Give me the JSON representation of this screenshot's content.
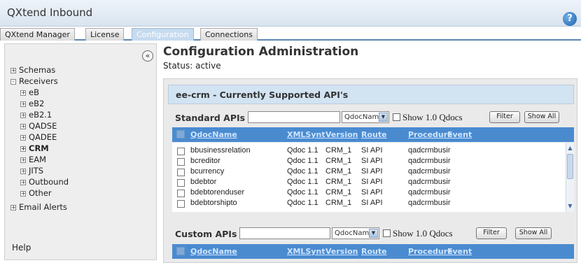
{
  "app": {
    "title": "QXtend Inbound",
    "help_glyph": "?"
  },
  "tabs": [
    {
      "label": "QXtend Manager",
      "active": false
    },
    {
      "label": "License",
      "active": false
    },
    {
      "label": "Configuration",
      "active": true
    },
    {
      "label": "Connections",
      "active": false
    }
  ],
  "sidebar": {
    "collapse_glyph": "«",
    "items": [
      {
        "label": "Schemas",
        "expander": "+"
      },
      {
        "label": "Receivers",
        "expander": "-"
      },
      {
        "label": "eB",
        "expander": "+"
      },
      {
        "label": "eB2",
        "expander": "+"
      },
      {
        "label": "eB2.1",
        "expander": "+"
      },
      {
        "label": "QADSE",
        "expander": "+"
      },
      {
        "label": "QADEE",
        "expander": "+"
      },
      {
        "label": "CRM",
        "expander": "+"
      },
      {
        "label": "EAM",
        "expander": "+"
      },
      {
        "label": "JITS",
        "expander": "+"
      },
      {
        "label": "Outbound",
        "expander": "+"
      },
      {
        "label": "Other",
        "expander": "+"
      },
      {
        "label": "Email Alerts",
        "expander": "+"
      }
    ],
    "help_label": "Help"
  },
  "main": {
    "title": "Configuration Administration",
    "status": "Status: active",
    "panel_title": "ee-crm - Currently Supported API's"
  },
  "standard": {
    "label": "Standard APIs",
    "select_value": "QdocName",
    "show_label": "Show 1.0 Qdocs",
    "filter_label": "Filter",
    "show_all_label": "Show All",
    "columns": [
      "QdocName",
      "XMLSynt",
      "Version",
      "Route",
      "Procedure",
      "Event"
    ],
    "rows": [
      [
        "bbusinessrelation",
        "Qdoc 1.1",
        "CRM_1",
        "SI API",
        "qadcrmbusir",
        ""
      ],
      [
        "bcreditor",
        "Qdoc 1.1",
        "CRM_1",
        "SI API",
        "qadcrmbusir",
        ""
      ],
      [
        "bcurrency",
        "Qdoc 1.1",
        "CRM_1",
        "SI API",
        "qadcrmbusir",
        ""
      ],
      [
        "bdebtor",
        "Qdoc 1.1",
        "CRM_1",
        "SI API",
        "qadcrmbusir",
        ""
      ],
      [
        "bdebtorenduser",
        "Qdoc 1.1",
        "CRM_1",
        "SI API",
        "qadcrmbusir",
        ""
      ],
      [
        "bdebtorshipto",
        "Qdoc 1.1",
        "CRM_1",
        "SI API",
        "qadcrmbusir",
        ""
      ]
    ]
  },
  "custom": {
    "label": "Custom APIs",
    "select_value": "QdocName",
    "show_label": "Show 1.0 Qdocs",
    "filter_label": "Filter",
    "show_all_label": "Show All",
    "columns": [
      "QdocName",
      "XMLSynt",
      "Version",
      "Route",
      "Procedure",
      "Event"
    ]
  },
  "colors": {
    "grid_header": "#4a8bd0",
    "panel_header": "#d2e3f2",
    "tab_active": "#c6dbef"
  }
}
